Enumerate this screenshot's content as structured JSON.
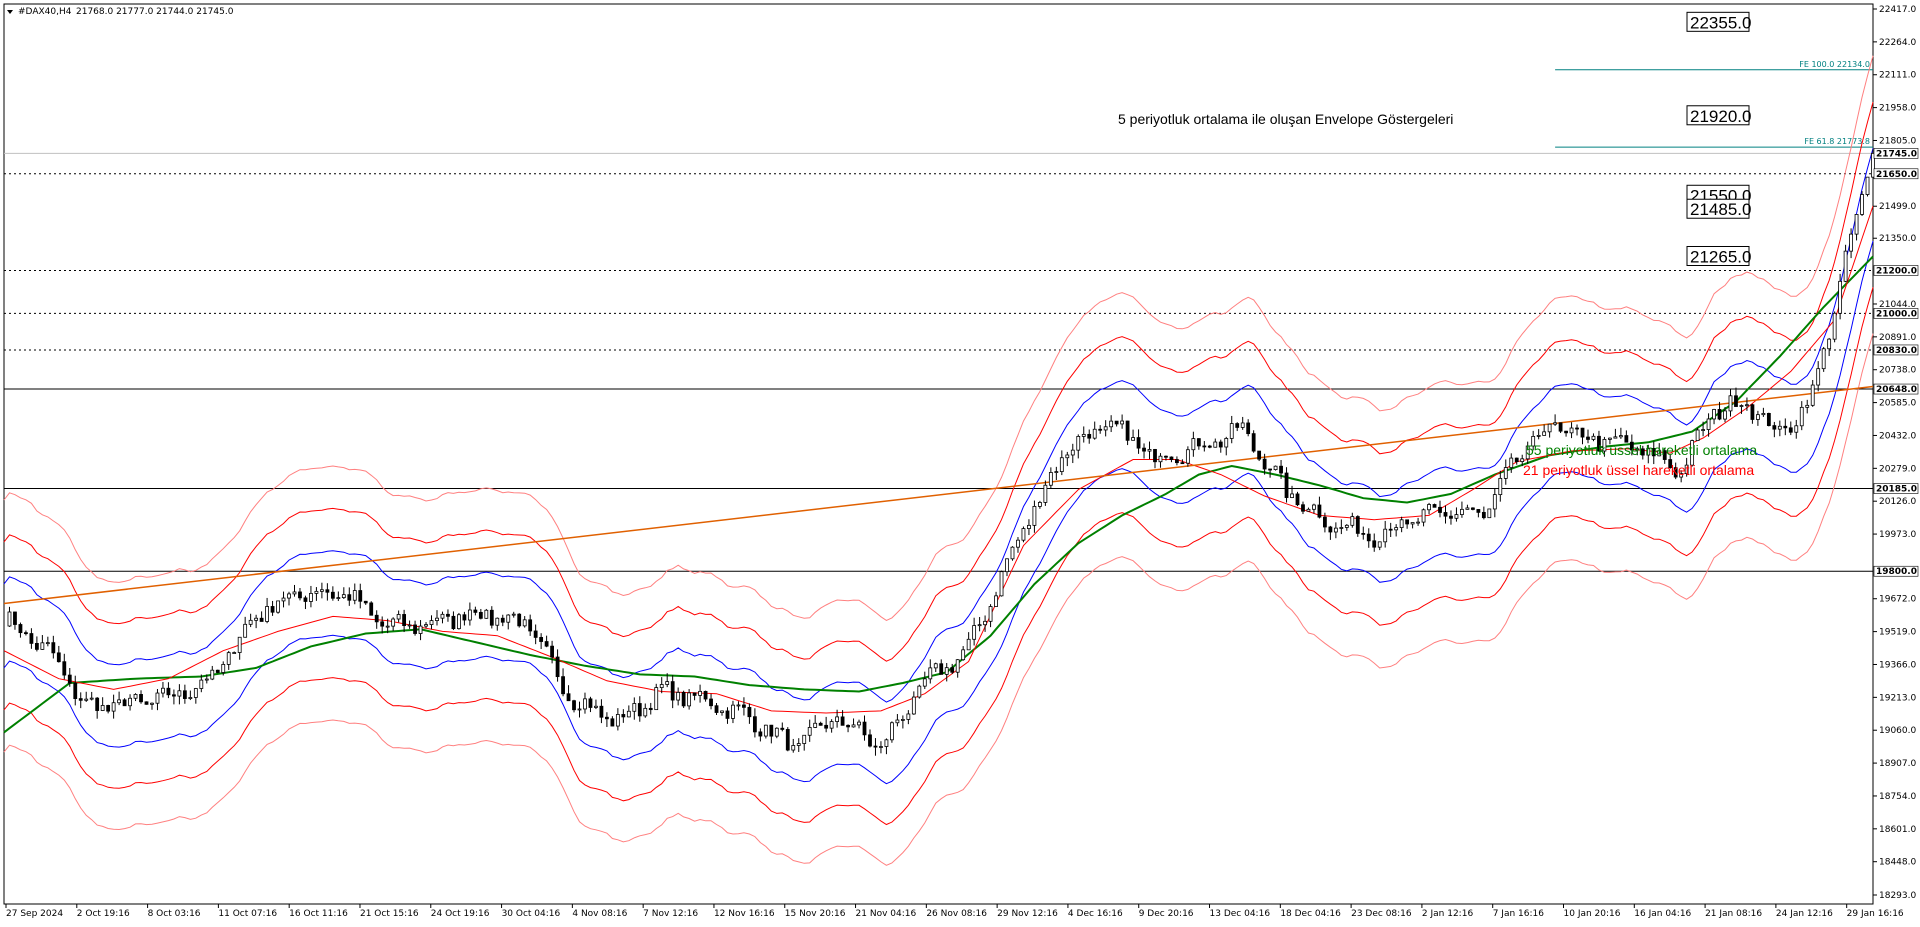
{
  "header": {
    "symbol": "#DAX40,H4",
    "ohlc": "21768.0 21777.0 21744.0 21745.0"
  },
  "annotations": {
    "envelope": "5 periyotluk ortalama ile oluşan Envelope Göstergeleri",
    "ema55": "55 periyotluk üssel hareketli ortalama",
    "ema21": "21 periyotluk üssel hareketli ortalama",
    "fe100": "FE 100.0 22134.0",
    "fe618": "FE 61.8 21773.8"
  },
  "colors": {
    "ema55": "#008000",
    "ema21": "#ff0000",
    "env_inner": "#0000ff",
    "env_mid": "#ff0000",
    "env_outer": "#ff8080",
    "trend": "#e06000",
    "fib": "#008080",
    "candle": "#000000"
  },
  "chart_data": {
    "type": "line",
    "ylim": [
      18293,
      22417
    ],
    "y_ticks": [
      "22417.0",
      "22264.0",
      "22111.0",
      "21958.0",
      "21805.0",
      "21499.0",
      "21350.0",
      "21044.0",
      "20891.0",
      "20738.0",
      "20585.0",
      "20432.0",
      "20279.0",
      "20126.0",
      "19973.0",
      "19672.0",
      "19519.0",
      "19366.0",
      "19213.0",
      "19060.0",
      "18907.0",
      "18754.0",
      "18601.0",
      "18448.0",
      "18293.0"
    ],
    "x_labels": [
      "27 Sep 2024",
      "2 Oct 19:16",
      "8 Oct 03:16",
      "11 Oct 07:16",
      "16 Oct 11:16",
      "21 Oct 15:16",
      "24 Oct 19:16",
      "30 Oct 04:16",
      "4 Nov 08:16",
      "7 Nov 12:16",
      "12 Nov 16:16",
      "15 Nov 20:16",
      "21 Nov 04:16",
      "26 Nov 08:16",
      "29 Nov 12:16",
      "4 Dec 16:16",
      "9 Dec 20:16",
      "13 Dec 04:16",
      "18 Dec 04:16",
      "23 Dec 08:16",
      "2 Jan 12:16",
      "7 Jan 16:16",
      "10 Jan 20:16",
      "16 Jan 04:16",
      "21 Jan 08:16",
      "24 Jan 12:16",
      "29 Jan 16:16"
    ],
    "price_tags": [
      "21745.0",
      "21650.0",
      "21200.0",
      "21000.0",
      "20830.0",
      "20648.0",
      "20185.0",
      "19800.0"
    ],
    "dotted_levels": [
      21650,
      21200,
      21000,
      20830
    ],
    "solid_levels": [
      20648,
      20185,
      19800
    ],
    "current_price": 21745,
    "level_boxes": [
      "22355.0",
      "21920.0",
      "21550.0",
      "21485.0",
      "21265.0"
    ],
    "fib_levels": [
      {
        "label": "FE 100.0 22134.0",
        "value": 22134
      },
      {
        "label": "FE 61.8 21773.8",
        "value": 21773.8
      }
    ],
    "trendline": {
      "from": [
        0,
        19650
      ],
      "to": [
        341,
        20660
      ]
    },
    "price": [
      [
        0,
        19580
      ],
      [
        8,
        19430
      ],
      [
        15,
        19170
      ],
      [
        22,
        19180
      ],
      [
        30,
        19210
      ],
      [
        38,
        19300
      ],
      [
        46,
        19600
      ],
      [
        54,
        19700
      ],
      [
        62,
        19700
      ],
      [
        70,
        19540
      ],
      [
        78,
        19560
      ],
      [
        86,
        19610
      ],
      [
        95,
        19560
      ],
      [
        104,
        19200
      ],
      [
        112,
        19100
      ],
      [
        120,
        19240
      ],
      [
        128,
        19200
      ],
      [
        136,
        19120
      ],
      [
        144,
        18980
      ],
      [
        152,
        19120
      ],
      [
        160,
        18980
      ],
      [
        168,
        19280
      ],
      [
        176,
        19440
      ],
      [
        186,
        20000
      ],
      [
        194,
        20380
      ],
      [
        202,
        20480
      ],
      [
        210,
        20330
      ],
      [
        218,
        20380
      ],
      [
        226,
        20460
      ],
      [
        234,
        20170
      ],
      [
        242,
        20020
      ],
      [
        250,
        19970
      ],
      [
        258,
        20040
      ],
      [
        264,
        20080
      ],
      [
        270,
        20060
      ],
      [
        276,
        20320
      ],
      [
        282,
        20480
      ],
      [
        288,
        20420
      ],
      [
        294,
        20400
      ],
      [
        300,
        20350
      ],
      [
        306,
        20270
      ],
      [
        312,
        20550
      ],
      [
        318,
        20590
      ],
      [
        324,
        20430
      ],
      [
        330,
        20620
      ],
      [
        336,
        21240
      ],
      [
        341,
        21745
      ]
    ],
    "ema21": [
      [
        0,
        19430
      ],
      [
        10,
        19300
      ],
      [
        20,
        19250
      ],
      [
        30,
        19300
      ],
      [
        40,
        19430
      ],
      [
        50,
        19520
      ],
      [
        60,
        19590
      ],
      [
        70,
        19570
      ],
      [
        80,
        19520
      ],
      [
        90,
        19500
      ],
      [
        100,
        19400
      ],
      [
        110,
        19290
      ],
      [
        120,
        19240
      ],
      [
        130,
        19230
      ],
      [
        140,
        19150
      ],
      [
        150,
        19140
      ],
      [
        160,
        19150
      ],
      [
        168,
        19230
      ],
      [
        176,
        19380
      ],
      [
        186,
        19920
      ],
      [
        196,
        20180
      ],
      [
        206,
        20320
      ],
      [
        214,
        20320
      ],
      [
        222,
        20250
      ],
      [
        230,
        20150
      ],
      [
        240,
        20060
      ],
      [
        250,
        20040
      ],
      [
        260,
        20060
      ],
      [
        268,
        20180
      ],
      [
        276,
        20310
      ],
      [
        286,
        20360
      ],
      [
        296,
        20370
      ],
      [
        304,
        20350
      ],
      [
        310,
        20420
      ],
      [
        318,
        20560
      ],
      [
        326,
        20730
      ],
      [
        334,
        20970
      ],
      [
        341,
        21500
      ]
    ],
    "ema55": [
      [
        0,
        19050
      ],
      [
        12,
        19280
      ],
      [
        24,
        19300
      ],
      [
        36,
        19310
      ],
      [
        46,
        19350
      ],
      [
        56,
        19450
      ],
      [
        66,
        19510
      ],
      [
        76,
        19530
      ],
      [
        86,
        19470
      ],
      [
        96,
        19410
      ],
      [
        106,
        19360
      ],
      [
        116,
        19320
      ],
      [
        126,
        19310
      ],
      [
        136,
        19270
      ],
      [
        146,
        19250
      ],
      [
        156,
        19240
      ],
      [
        164,
        19280
      ],
      [
        172,
        19330
      ],
      [
        180,
        19500
      ],
      [
        188,
        19740
      ],
      [
        196,
        19930
      ],
      [
        204,
        20060
      ],
      [
        212,
        20160
      ],
      [
        218,
        20250
      ],
      [
        224,
        20290
      ],
      [
        232,
        20250
      ],
      [
        240,
        20200
      ],
      [
        248,
        20140
      ],
      [
        256,
        20120
      ],
      [
        264,
        20160
      ],
      [
        272,
        20250
      ],
      [
        282,
        20340
      ],
      [
        292,
        20380
      ],
      [
        300,
        20400
      ],
      [
        308,
        20450
      ],
      [
        316,
        20590
      ],
      [
        324,
        20800
      ],
      [
        332,
        21030
      ],
      [
        341,
        21265
      ]
    ],
    "envelope": {
      "inner_pct": 1.0,
      "mid_pct": 2.0,
      "outer_pct": 3.0
    }
  }
}
